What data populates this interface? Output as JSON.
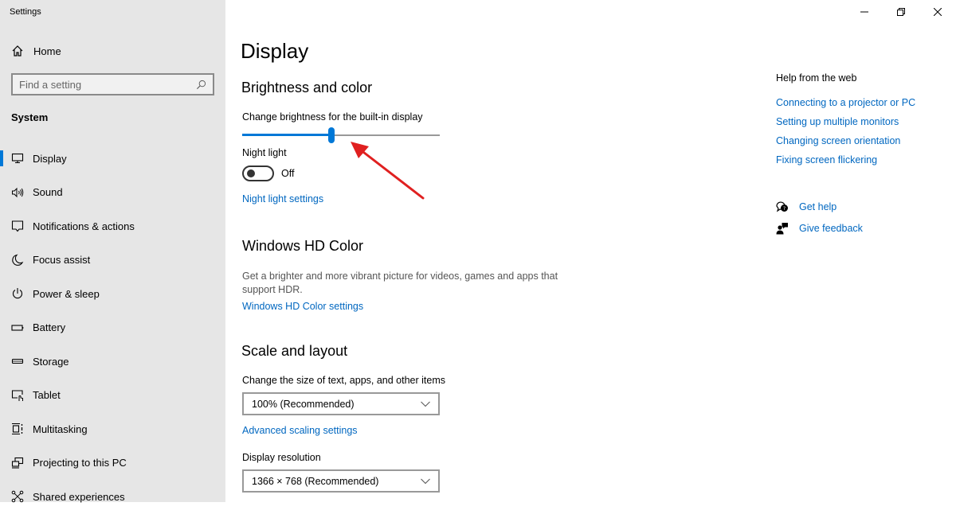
{
  "window": {
    "title": "Settings",
    "controls": [
      "minimize",
      "restore",
      "close"
    ]
  },
  "sidebar": {
    "home_label": "Home",
    "search_placeholder": "Find a setting",
    "section": "System",
    "items": [
      {
        "label": "Display",
        "icon": "monitor-icon",
        "active": true
      },
      {
        "label": "Sound",
        "icon": "speaker-icon"
      },
      {
        "label": "Notifications & actions",
        "icon": "notification-icon"
      },
      {
        "label": "Focus assist",
        "icon": "moon-icon"
      },
      {
        "label": "Power & sleep",
        "icon": "power-icon"
      },
      {
        "label": "Battery",
        "icon": "battery-icon"
      },
      {
        "label": "Storage",
        "icon": "storage-icon"
      },
      {
        "label": "Tablet",
        "icon": "tablet-icon"
      },
      {
        "label": "Multitasking",
        "icon": "multitasking-icon"
      },
      {
        "label": "Projecting to this PC",
        "icon": "projecting-icon"
      },
      {
        "label": "Shared experiences",
        "icon": "shared-experiences-icon"
      }
    ]
  },
  "main": {
    "title": "Display",
    "brightness": {
      "heading": "Brightness and color",
      "slider_label": "Change brightness for the built-in display",
      "value_percent": 45,
      "night_light_label": "Night light",
      "night_light_state": "Off",
      "night_light_link": "Night light settings"
    },
    "hdr": {
      "heading": "Windows HD Color",
      "description": "Get a brighter and more vibrant picture for videos, games and apps that support HDR.",
      "link": "Windows HD Color settings"
    },
    "scale": {
      "heading": "Scale and layout",
      "size_label": "Change the size of text, apps, and other items",
      "size_value": "100% (Recommended)",
      "advanced_link": "Advanced scaling settings",
      "resolution_label": "Display resolution",
      "resolution_value": "1366 × 768 (Recommended)"
    }
  },
  "help": {
    "heading": "Help from the web",
    "links": [
      "Connecting to a projector or PC",
      "Setting up multiple monitors",
      "Changing screen orientation",
      "Fixing screen flickering"
    ],
    "get_help": "Get help",
    "give_feedback": "Give feedback"
  },
  "colors": {
    "accent": "#0078d7",
    "link": "#0067c0",
    "sidebar_bg": "#e6e6e6",
    "annotation_arrow": "#e02020"
  }
}
